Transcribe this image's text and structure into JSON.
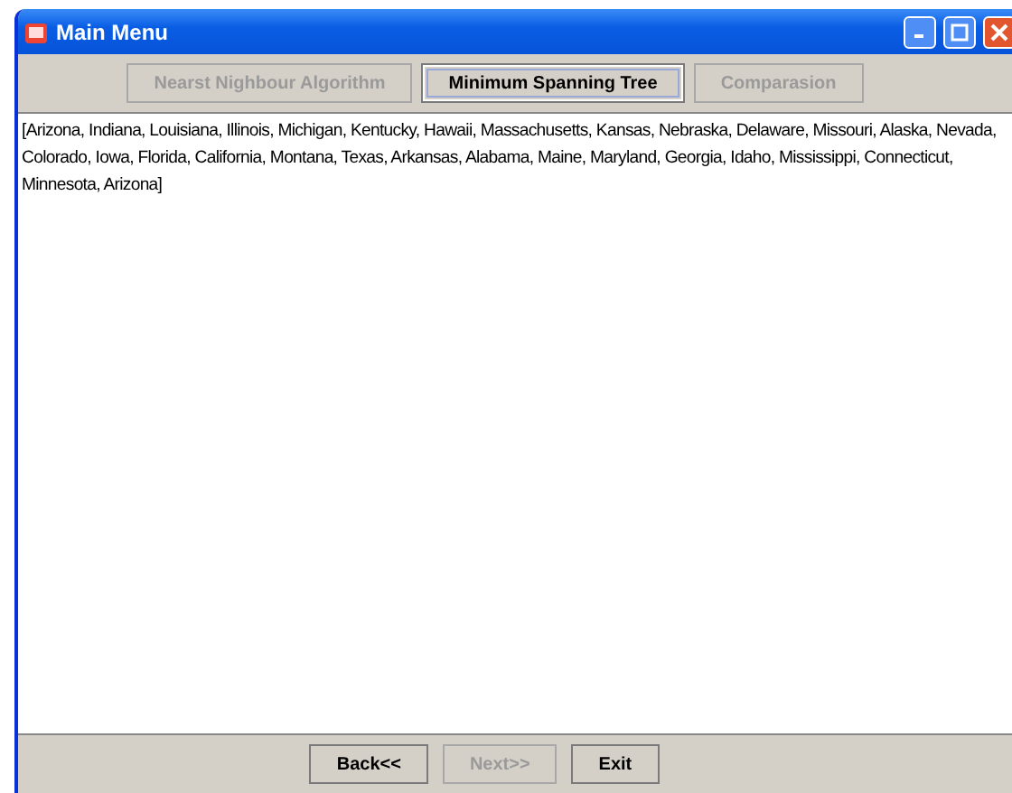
{
  "window": {
    "title": "Main Menu"
  },
  "tabs": [
    {
      "label": "Nearst Nighbour Algorithm",
      "disabled": true,
      "selected": false
    },
    {
      "label": "Minimum Spanning Tree",
      "disabled": false,
      "selected": true
    },
    {
      "label": "Comparasion",
      "disabled": true,
      "selected": false
    }
  ],
  "output": "[Arizona, Indiana, Louisiana, Illinois, Michigan, Kentucky, Hawaii, Massachusetts, Kansas, Nebraska, Delaware, Missouri, Alaska, Nevada, Colorado, Iowa, Florida, California, Montana, Texas, Arkansas, Alabama, Maine, Maryland, Georgia, Idaho, Mississippi, Connecticut, Minnesota, Arizona]",
  "buttons": [
    {
      "label": "Back<<",
      "disabled": false
    },
    {
      "label": "Next>>",
      "disabled": true
    },
    {
      "label": "Exit",
      "disabled": false
    }
  ]
}
